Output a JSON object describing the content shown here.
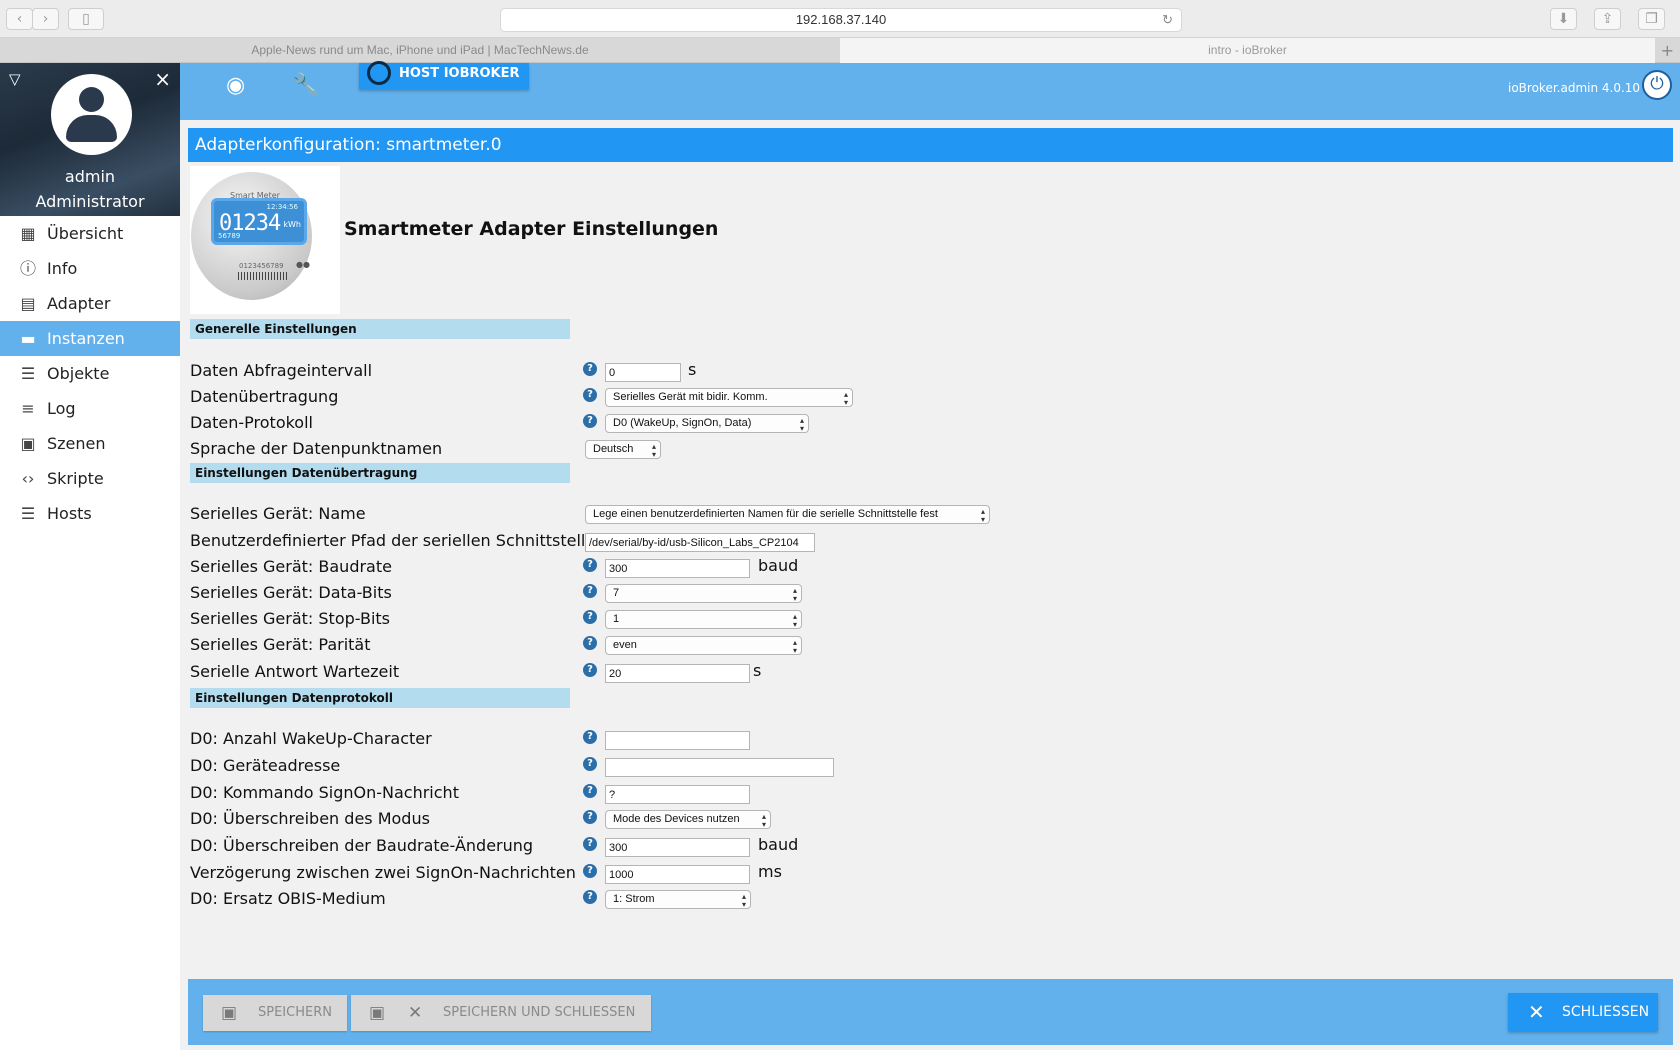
{
  "browser": {
    "url": "192.168.37.140",
    "tabs": [
      "Apple-News rund um Mac, iPhone und iPad | MacTechNews.de",
      "intro - ioBroker"
    ]
  },
  "user": {
    "name": "admin",
    "role": "Administrator"
  },
  "menu": [
    {
      "label": "Übersicht",
      "icon": "grid-icon"
    },
    {
      "label": "Info",
      "icon": "info-icon"
    },
    {
      "label": "Adapter",
      "icon": "store-icon"
    },
    {
      "label": "Instanzen",
      "icon": "instances-icon",
      "active": true
    },
    {
      "label": "Objekte",
      "icon": "list-icon"
    },
    {
      "label": "Log",
      "icon": "log-icon"
    },
    {
      "label": "Szenen",
      "icon": "scenes-icon"
    },
    {
      "label": "Skripte",
      "icon": "code-icon"
    },
    {
      "label": "Hosts",
      "icon": "hosts-icon"
    }
  ],
  "topbar": {
    "host_label": "HOST IOBROKER",
    "version": "ioBroker.admin 4.0.10"
  },
  "page": {
    "title": "Adapterkonfiguration: smartmeter.0",
    "heading": "Smartmeter Adapter Einstellungen",
    "meter_image": {
      "brand": "Smart Meter",
      "reading": "01234",
      "time": "12:34:56",
      "unit": "kWh",
      "sub": "56789",
      "serial": "0123456789"
    }
  },
  "sections": {
    "general": "Generelle Einstellungen",
    "transfer": "Einstellungen Datenübertragung",
    "protocol": "Einstellungen Datenprotokoll"
  },
  "fields": {
    "interval": {
      "label": "Daten Abfrageintervall",
      "value": "0",
      "unit": "s"
    },
    "transfer": {
      "label": "Datenübertragung",
      "value": "Serielles Gerät mit bidir. Komm."
    },
    "protocol": {
      "label": "Daten-Protokoll",
      "value": "D0 (WakeUp, SignOn, Data)"
    },
    "language": {
      "label": "Sprache der Datenpunktnamen",
      "value": "Deutsch"
    },
    "serial_name": {
      "label": "Serielles Gerät: Name",
      "value": "Lege einen benutzerdefinierten Namen für die serielle Schnittstelle fest"
    },
    "serial_path": {
      "label": "Benutzerdefinierter Pfad der seriellen Schnittstelle",
      "value": "/dev/serial/by-id/usb-Silicon_Labs_CP2104"
    },
    "baudrate": {
      "label": "Serielles Gerät: Baudrate",
      "value": "300",
      "unit": "baud"
    },
    "databits": {
      "label": "Serielles Gerät: Data-Bits",
      "value": "7"
    },
    "stopbits": {
      "label": "Serielles Gerät: Stop-Bits",
      "value": "1"
    },
    "parity": {
      "label": "Serielles Gerät: Parität",
      "value": "even"
    },
    "response_wait": {
      "label": "Serielle Antwort Wartezeit",
      "value": "20",
      "unit": "s"
    },
    "wakeup_chars": {
      "label": "D0: Anzahl WakeUp-Character",
      "value": ""
    },
    "device_address": {
      "label": "D0: Geräteadresse",
      "value": ""
    },
    "signon_command": {
      "label": "D0: Kommando SignOn-Nachricht",
      "value": "?"
    },
    "mode_override": {
      "label": "D0: Überschreiben des Modus",
      "value": "Mode des Devices nutzen"
    },
    "baud_override": {
      "label": "D0: Überschreiben der Baudrate-Änderung",
      "value": "300",
      "unit": "baud"
    },
    "signon_delay": {
      "label": "Verzögerung zwischen zwei SignOn-Nachrichten",
      "value": "1000",
      "unit": "ms"
    },
    "obis_medium": {
      "label": "D0: Ersatz OBIS-Medium",
      "value": "1: Strom"
    }
  },
  "footer": {
    "save": "SPEICHERN",
    "save_close": "SPEICHERN UND SCHLIESSEN",
    "close": "SCHLIESSEN"
  },
  "colors": {
    "accent": "#2196f3",
    "bar": "#63b1ec",
    "section": "#b3dcef",
    "background": "#f1f1f1"
  }
}
